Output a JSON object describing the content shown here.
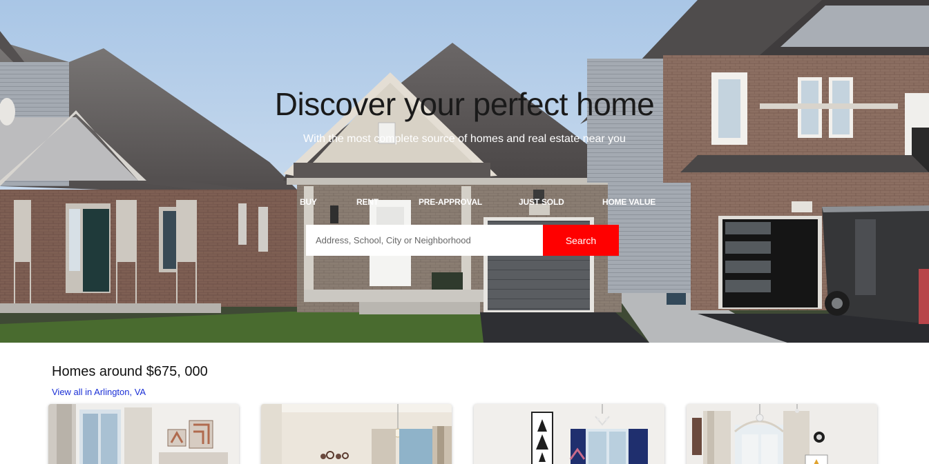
{
  "hero": {
    "title": "Discover your perfect home",
    "subtitle": "With the most complete source of homes and real estate near you",
    "nav": [
      "BUY",
      "RENT",
      "PRE-APPROVAL",
      "JUST SOLD",
      "HOME VALUE"
    ]
  },
  "search": {
    "placeholder": "Address, School, City or Neighborhood",
    "button_label": "Search"
  },
  "listings": {
    "title": "Homes around $675, 000",
    "view_all_label": "View all in Arlington, VA",
    "cards": [
      {
        "name": "listing-card-1"
      },
      {
        "name": "listing-card-2"
      },
      {
        "name": "listing-card-3"
      },
      {
        "name": "listing-card-4"
      }
    ]
  },
  "colors": {
    "accent": "#ff0000",
    "link": "#1a2fd6",
    "hero_text": "#ffffff",
    "title_text": "#1a1a1a"
  }
}
